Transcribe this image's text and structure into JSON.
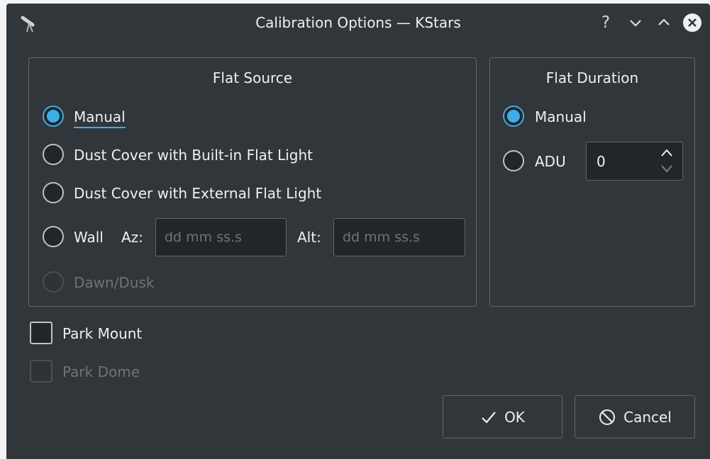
{
  "window": {
    "title": "Calibration Options — KStars",
    "help_label": "?"
  },
  "flat_source": {
    "title": "Flat Source",
    "options": [
      {
        "label": "Manual",
        "checked": true,
        "enabled": true
      },
      {
        "label": "Dust Cover with Built-in Flat Light",
        "checked": false,
        "enabled": true
      },
      {
        "label": "Dust Cover with External Flat Light",
        "checked": false,
        "enabled": true
      },
      {
        "label": "Wall",
        "checked": false,
        "enabled": true
      },
      {
        "label": "Dawn/Dusk",
        "checked": false,
        "enabled": false
      }
    ],
    "az_label": "Az:",
    "az_placeholder": "dd mm ss.s",
    "alt_label": "Alt:",
    "alt_placeholder": "dd mm ss.s"
  },
  "flat_duration": {
    "title": "Flat Duration",
    "options": [
      {
        "label": "Manual",
        "checked": true
      },
      {
        "label": "ADU",
        "checked": false
      }
    ],
    "adu_value": "0"
  },
  "park_mount": {
    "label": "Park Mount",
    "checked": false,
    "enabled": true
  },
  "park_dome": {
    "label": "Park Dome",
    "checked": false,
    "enabled": false
  },
  "buttons": {
    "ok_label": "OK",
    "cancel_label": "Cancel"
  },
  "colors": {
    "window_bg": "#31363b",
    "accent": "#3daee9",
    "text": "#eff0f1",
    "disabled_text": "#6e7378"
  },
  "icons": {
    "app": "telescope-icon",
    "minimize": "chevron-down-icon",
    "maximize": "chevron-up-icon",
    "close": "close-icon",
    "ok": "checkmark-icon",
    "cancel": "cancel-icon"
  }
}
